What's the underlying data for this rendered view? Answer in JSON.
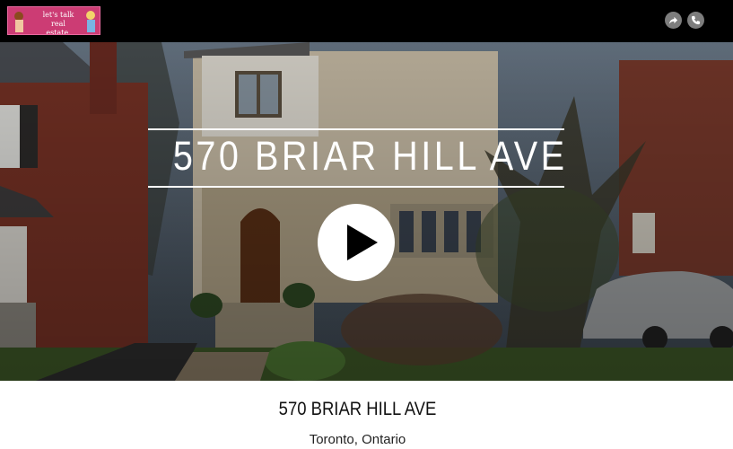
{
  "header": {
    "logo_text": "let's talk real estate.",
    "share_icon": "share-icon",
    "phone_icon": "phone-icon"
  },
  "hero": {
    "title": "570 BRIAR HILL AVE",
    "play_icon": "play-icon"
  },
  "listing": {
    "address": "570 BRIAR HILL AVE",
    "city": "Toronto, Ontario"
  },
  "colors": {
    "logo_background": "#cc3c74",
    "header_background": "#000000",
    "icon_button": "#7d7d7d"
  }
}
